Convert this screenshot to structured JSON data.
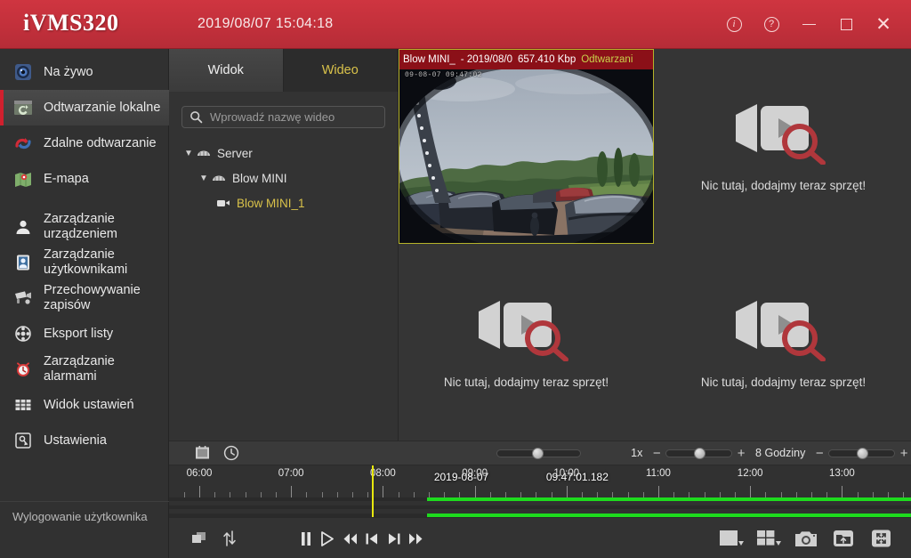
{
  "titlebar": {
    "logo": "iVMS320",
    "datetime": "2019/08/07 15:04:18",
    "buttons": [
      {
        "name": "info-button",
        "label": "i"
      },
      {
        "name": "help-button",
        "label": "?"
      },
      {
        "name": "minimize-button",
        "label": "—"
      },
      {
        "name": "maximize-button",
        "label": "□"
      },
      {
        "name": "close-button",
        "label": "✕"
      }
    ],
    "accent_color": "#c2303b"
  },
  "sidebar": {
    "items": [
      {
        "label": "Na żywo",
        "icon": "live-camera-icon",
        "active": false
      },
      {
        "label": "Odtwarzanie lokalne",
        "icon": "local-playback-icon",
        "active": true
      },
      {
        "label": "Zdalne odtwarzanie",
        "icon": "remote-playback-icon",
        "active": false
      },
      {
        "label": "E-mapa",
        "icon": "map-icon",
        "active": false
      },
      {
        "label": "Zarządzanie urządzeniem",
        "icon": "device-manage-icon",
        "active": false
      },
      {
        "label": "Zarządzanie użytkownikami",
        "icon": "user-manage-icon",
        "active": false
      },
      {
        "label": "Przechowywanie zapisów",
        "icon": "record-storage-icon",
        "active": false
      },
      {
        "label": "Eksport listy",
        "icon": "export-list-icon",
        "active": false
      },
      {
        "label": "Zarządzanie alarmami",
        "icon": "alarm-manage-icon",
        "active": false
      },
      {
        "label": "Widok ustawień",
        "icon": "view-settings-icon",
        "active": false
      },
      {
        "label": "Ustawienia",
        "icon": "settings-icon",
        "active": false
      }
    ],
    "logout": "Wylogowanie użytkownika",
    "active_accent": "#d0202e"
  },
  "tree_panel": {
    "tabs": [
      {
        "label": "Widok",
        "active": true
      },
      {
        "label": "Wideo",
        "active": false,
        "color": "#d9c24a"
      }
    ],
    "search": {
      "placeholder": "Wprowadź nazwę wideo",
      "value": "",
      "icon": "search-icon"
    },
    "nodes": [
      {
        "label": "Server",
        "level": 0,
        "expanded": true,
        "icon": "server-icon",
        "selected": false
      },
      {
        "label": "Blow MINI",
        "level": 1,
        "expanded": true,
        "icon": "server-icon",
        "selected": false
      },
      {
        "label": "Blow MINI_1",
        "level": 2,
        "expanded": false,
        "icon": "camera-icon",
        "selected": true
      }
    ]
  },
  "video_grid": {
    "cells": [
      {
        "occupied": true,
        "active": true,
        "header_title": "Blow MINI_",
        "header_date": "- 2019/08/0",
        "header_bitrate": "657.410 Kbp",
        "header_status": "Odtwarzani",
        "osd_time": "09-08-07  09:47:02"
      },
      {
        "occupied": false,
        "active": false,
        "empty_text": "Nic tutaj, dodajmy teraz sprzęt!"
      },
      {
        "occupied": false,
        "active": false,
        "empty_text": "Nic tutaj, dodajmy teraz sprzęt!"
      },
      {
        "occupied": false,
        "active": false,
        "empty_text": "Nic tutaj, dodajmy teraz sprzęt!"
      }
    ]
  },
  "timeline_toolbar": {
    "calendar_icon": "calendar-icon",
    "clock_icon": "clock-icon",
    "volume_slider": {
      "value": 45
    },
    "speed_label": "1x",
    "speed_slider": {
      "value": 50,
      "minus": "−",
      "plus": "+"
    },
    "range_label": "8 Godziny",
    "range_slider": {
      "value": 50,
      "minus": "−",
      "plus": "+"
    }
  },
  "timeline": {
    "hour_labels": [
      "06:00",
      "07:00",
      "08:00",
      "09:00",
      "10:00",
      "11:00",
      "12:00",
      "13:00"
    ],
    "playhead_date": "2019-08-07",
    "playhead_time": "09:47:01.182",
    "playhead_percent": 50.1,
    "recording_color": "#1ddb1d",
    "recordings": [
      {
        "track": 1,
        "start_percent": 34.8,
        "end_percent": 100
      },
      {
        "track": 3,
        "start_percent": 34.8,
        "end_percent": 100
      }
    ]
  },
  "bottom_bar": {
    "left_buttons": [
      {
        "name": "multi-window-button",
        "icon": "windows-icon"
      },
      {
        "name": "sync-sort-button",
        "icon": "sort-arrows-icon"
      }
    ],
    "transport_buttons": [
      {
        "name": "pause-button",
        "icon": "pause-icon"
      },
      {
        "name": "play-button",
        "icon": "play-icon"
      },
      {
        "name": "rewind-button",
        "icon": "rewind-icon"
      },
      {
        "name": "previous-frame-button",
        "icon": "previous-icon"
      },
      {
        "name": "next-frame-button",
        "icon": "next-icon"
      },
      {
        "name": "fast-forward-button",
        "icon": "fast-forward-icon"
      }
    ],
    "right_buttons": [
      {
        "name": "single-view-button",
        "icon": "single-pane-icon"
      },
      {
        "name": "layout-view-button",
        "icon": "grid-layout-icon"
      },
      {
        "name": "snapshot-button",
        "icon": "camera-icon"
      },
      {
        "name": "open-folder-button",
        "icon": "folder-upload-icon"
      },
      {
        "name": "fullscreen-button",
        "icon": "fullscreen-icon"
      }
    ]
  }
}
